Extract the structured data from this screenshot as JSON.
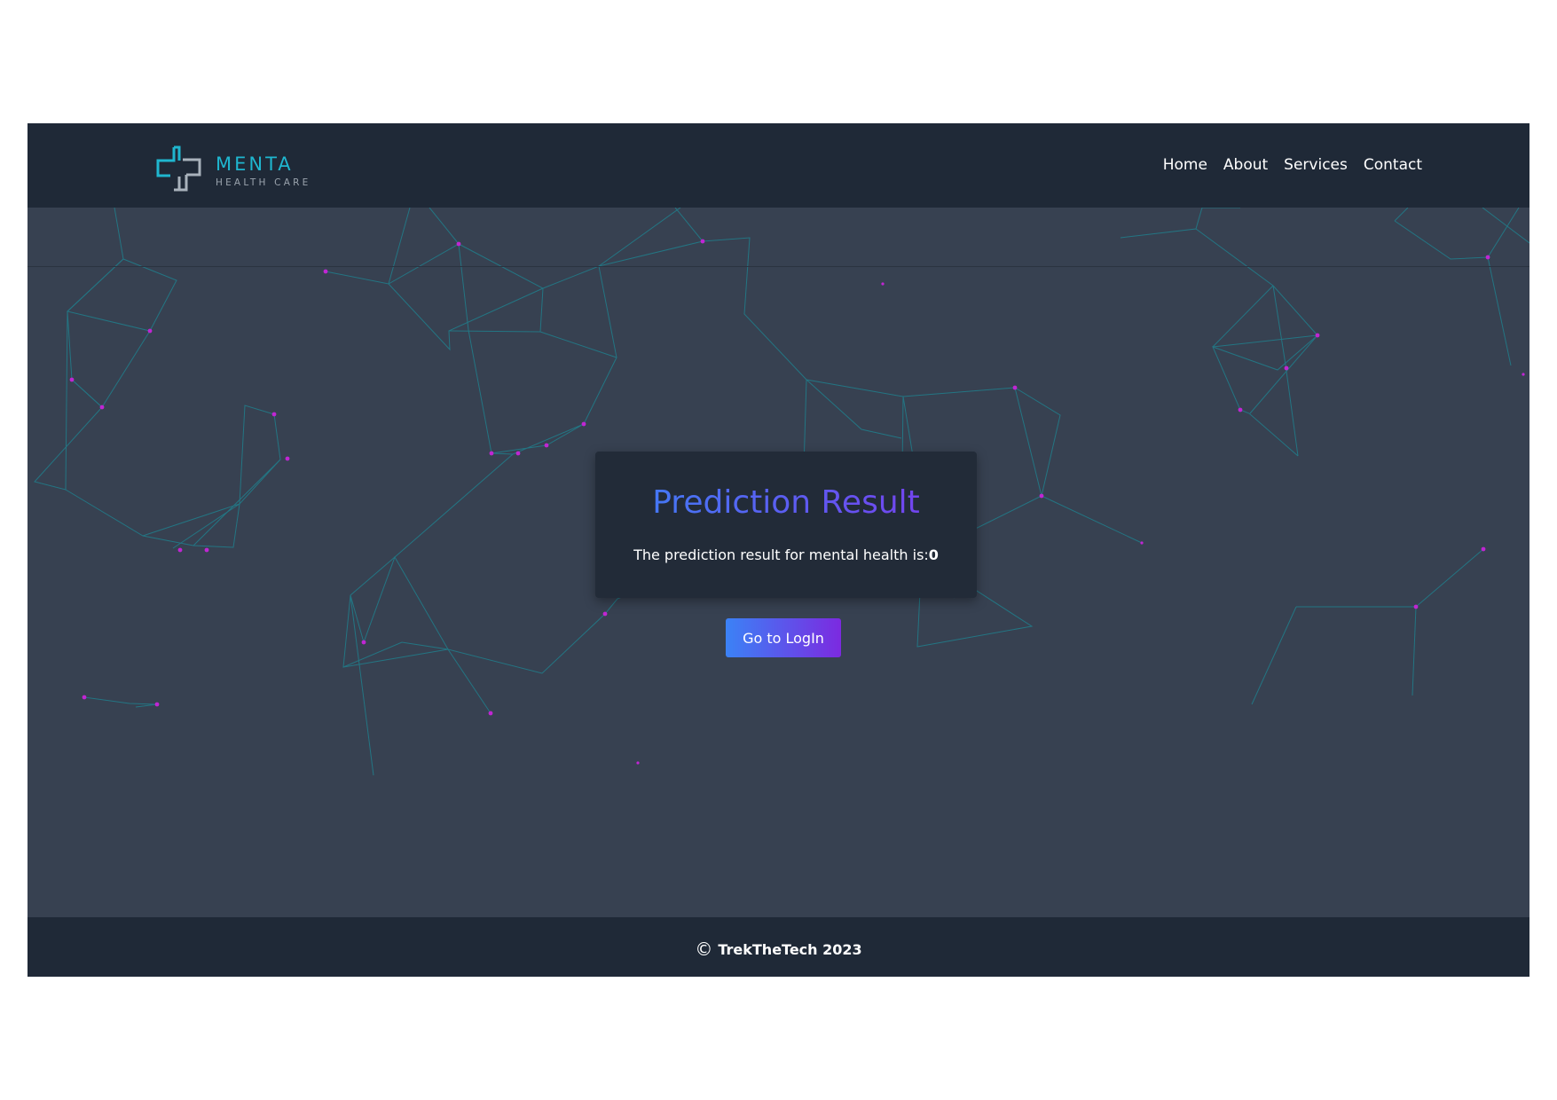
{
  "navbar": {
    "logo": {
      "brand": "MENTA",
      "subtitle": "HEALTH CARE",
      "icon": "medical-cross-icon"
    },
    "links": [
      "Home",
      "About",
      "Services",
      "Contact"
    ]
  },
  "card": {
    "title": "Prediction Result",
    "result_label": "The prediction result for mental health is:",
    "result_value": "0"
  },
  "button": {
    "label": "Go to LogIn"
  },
  "footer": {
    "copyright_symbol": "©",
    "text": "TrekTheTech 2023"
  },
  "colors": {
    "page_bg": "#ffffff",
    "content_bg": "#374151",
    "header_bg": "#1f2937",
    "card_bg": "#222b38",
    "accent_start": "#3b82f6",
    "accent_end": "#7c3aed",
    "network_line": "#1f8a96",
    "network_node": "#c026d3",
    "logo_teal": "#1fb6cf"
  }
}
